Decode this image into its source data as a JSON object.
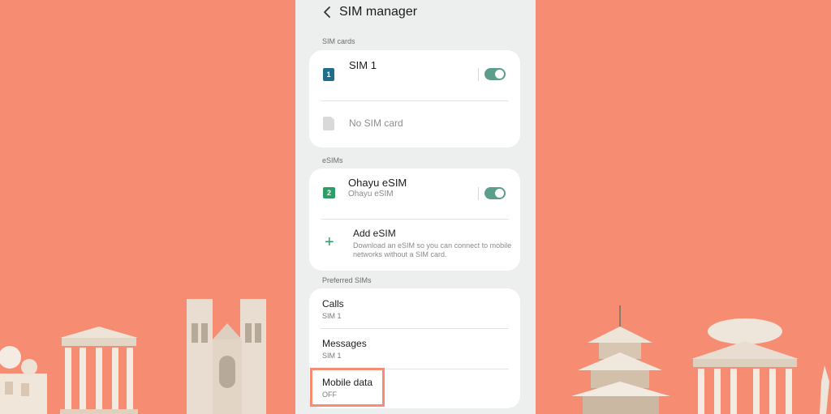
{
  "header": {
    "title": "SIM manager",
    "back_icon": "chevron-left-icon"
  },
  "sections": {
    "sim_cards": "SIM cards",
    "esims": "eSIMs",
    "preferred": "Preferred SIMs"
  },
  "sim_cards": [
    {
      "name": "SIM 1",
      "badge": "1",
      "badge_color": "#1F6E8C",
      "toggle_on": true
    },
    {
      "name": "No SIM card",
      "badge_color": "#D9D9D9"
    }
  ],
  "esims": [
    {
      "name": "Ohayu eSIM",
      "subtitle": "Ohayu eSIM",
      "badge": "2",
      "badge_color": "#2E9E67",
      "toggle_on": true
    }
  ],
  "add_esim": {
    "title": "Add eSIM",
    "description": "Download an eSIM so you can connect to mobile networks without a SIM card.",
    "icon": "plus-icon"
  },
  "preferred": [
    {
      "label": "Calls",
      "value": "SIM 1"
    },
    {
      "label": "Messages",
      "value": "SIM 1"
    },
    {
      "label": "Mobile data",
      "value": "OFF"
    }
  ],
  "colors": {
    "background": "#F68C72",
    "accent_toggle": "#5C9E8C",
    "highlight": "#F68C72"
  }
}
